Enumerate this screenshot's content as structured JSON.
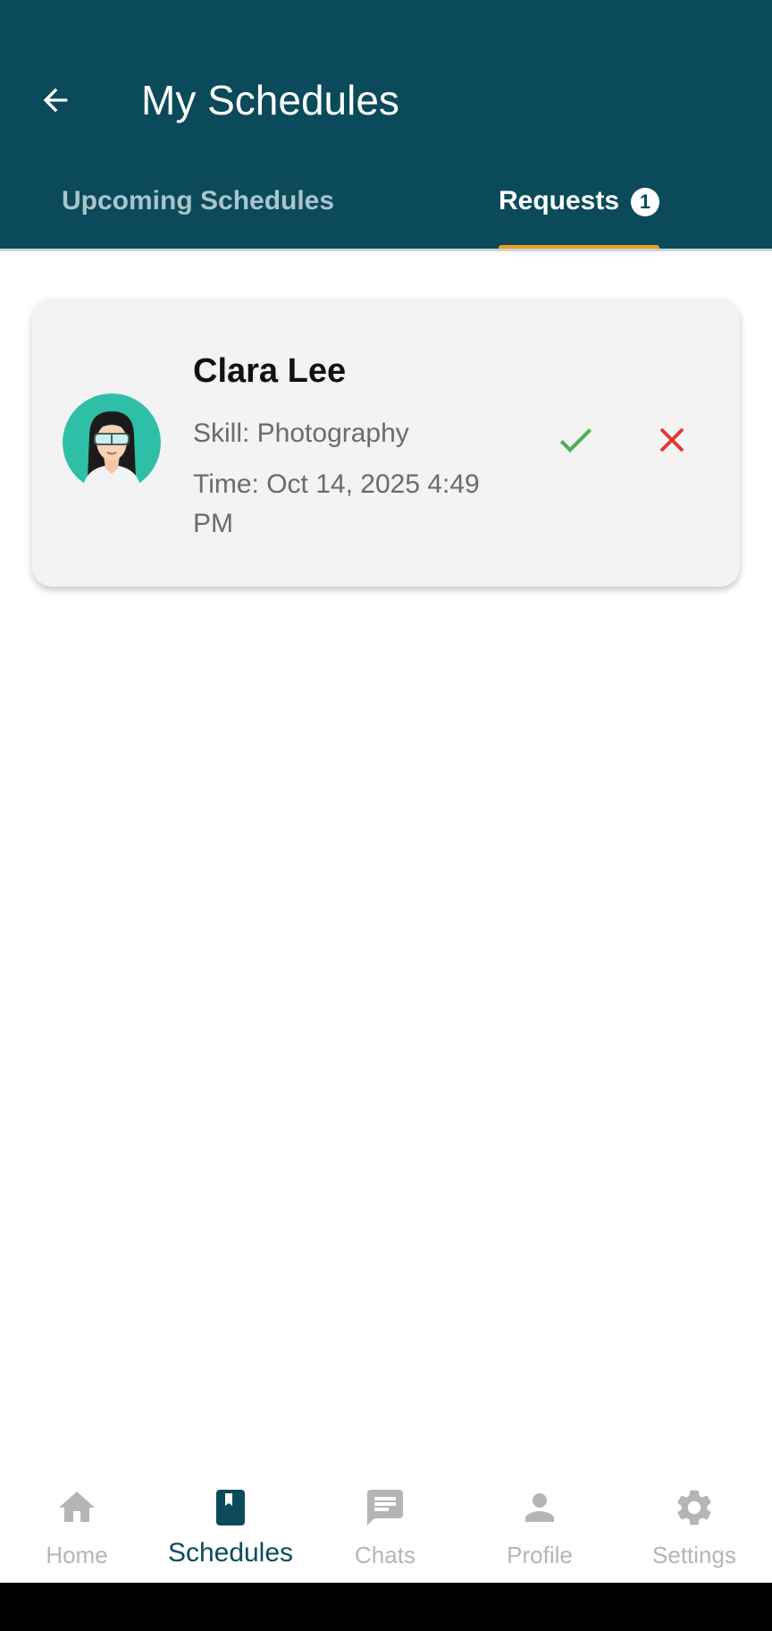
{
  "header": {
    "title": "My Schedules",
    "back_icon": "arrow-left-icon"
  },
  "tabs": [
    {
      "label": "Upcoming Schedules",
      "active": false
    },
    {
      "label": "Requests",
      "active": true,
      "badge": "1"
    }
  ],
  "requests": [
    {
      "name": "Clara Lee",
      "skill": "Skill: Photography",
      "time": "Time: Oct 14, 2025 4:49 PM",
      "avatar_icon": "woman-avatar-icon",
      "accept_icon": "check-icon",
      "reject_icon": "close-icon"
    }
  ],
  "bottom_nav": [
    {
      "label": "Home",
      "icon": "home-icon",
      "active": false
    },
    {
      "label": "Schedules",
      "icon": "bookmark-book-icon",
      "active": true
    },
    {
      "label": "Chats",
      "icon": "chat-icon",
      "active": false
    },
    {
      "label": "Profile",
      "icon": "person-icon",
      "active": false
    },
    {
      "label": "Settings",
      "icon": "gear-icon",
      "active": false
    }
  ],
  "colors": {
    "primary": "#0a4a5a",
    "tab_indicator": "#f39a1f",
    "accept": "#4caf50",
    "reject": "#e53935",
    "inactive": "#b5b5b5",
    "card_bg": "#f3f3f3"
  }
}
